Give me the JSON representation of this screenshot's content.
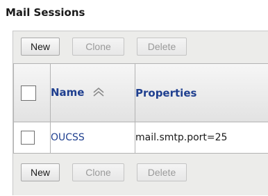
{
  "page": {
    "title": "Mail Sessions"
  },
  "toolbar": {
    "new_label": "New",
    "clone_label": "Clone",
    "delete_label": "Delete"
  },
  "table": {
    "columns": {
      "name": "Name",
      "properties": "Properties"
    },
    "rows": [
      {
        "name": "OUCSS",
        "properties": "mail.smtp.port=25"
      }
    ]
  },
  "icons": {
    "sort": "double-chevron-up-icon"
  },
  "colors": {
    "link": "#1f3f8f",
    "panel": "#ececea",
    "disabled_text": "#9a9a9a"
  }
}
